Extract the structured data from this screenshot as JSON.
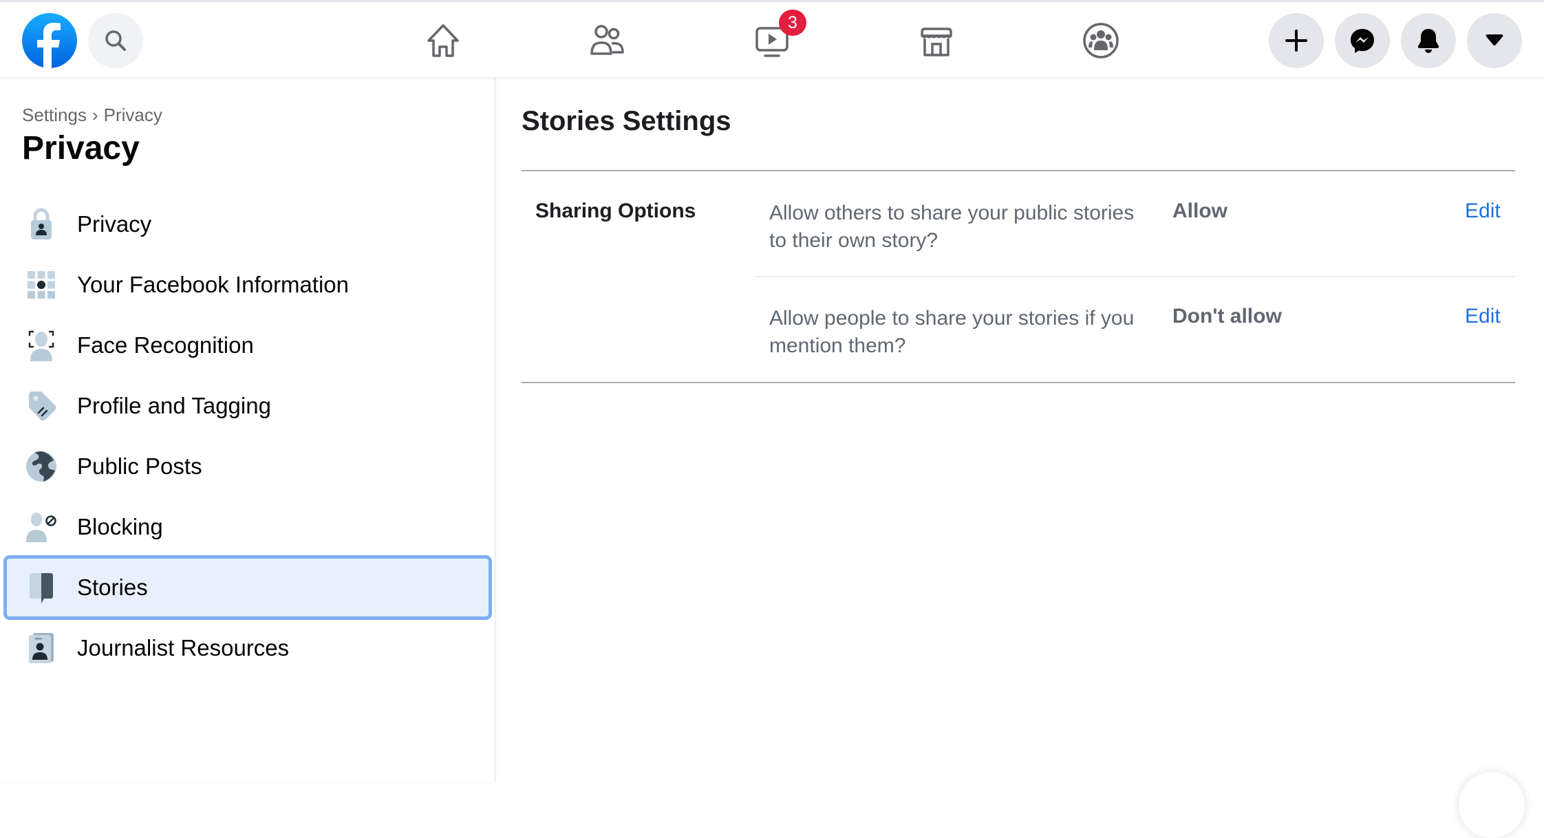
{
  "header": {
    "logo": "facebook-logo",
    "search_icon": "search-icon",
    "nav": [
      {
        "name": "home",
        "icon": "home-icon"
      },
      {
        "name": "friends",
        "icon": "friends-icon"
      },
      {
        "name": "watch",
        "icon": "watch-video-icon",
        "badge": "3"
      },
      {
        "name": "marketplace",
        "icon": "marketplace-store-icon"
      },
      {
        "name": "groups",
        "icon": "groups-icon"
      }
    ],
    "actions": [
      {
        "name": "create",
        "icon": "plus-icon"
      },
      {
        "name": "messenger",
        "icon": "messenger-icon"
      },
      {
        "name": "notifications",
        "icon": "bell-icon"
      },
      {
        "name": "account",
        "icon": "caret-down-icon"
      }
    ],
    "badge_color": "#e41e3f"
  },
  "sidebar": {
    "breadcrumb": [
      "Settings",
      "Privacy"
    ],
    "breadcrumb_separator": "›",
    "title": "Privacy",
    "items": [
      {
        "label": "Privacy",
        "icon": "lock-icon",
        "active": false
      },
      {
        "label": "Your Facebook Information",
        "icon": "info-grid-icon",
        "active": false
      },
      {
        "label": "Face Recognition",
        "icon": "face-recognition-icon",
        "active": false
      },
      {
        "label": "Profile and Tagging",
        "icon": "tag-icon",
        "active": false
      },
      {
        "label": "Public Posts",
        "icon": "globe-icon",
        "active": false
      },
      {
        "label": "Blocking",
        "icon": "block-user-icon",
        "active": false
      },
      {
        "label": "Stories",
        "icon": "stories-book-icon",
        "active": true
      },
      {
        "label": "Journalist Resources",
        "icon": "id-badge-icon",
        "active": false
      }
    ]
  },
  "main": {
    "title": "Stories Settings",
    "section": {
      "label": "Sharing Options",
      "rows": [
        {
          "question": "Allow others to share your public stories to their own story?",
          "value": "Allow",
          "action": "Edit"
        },
        {
          "question": "Allow people to share your stories if you mention them?",
          "value": "Don't allow",
          "action": "Edit"
        }
      ]
    },
    "link_color": "#216fdb"
  }
}
